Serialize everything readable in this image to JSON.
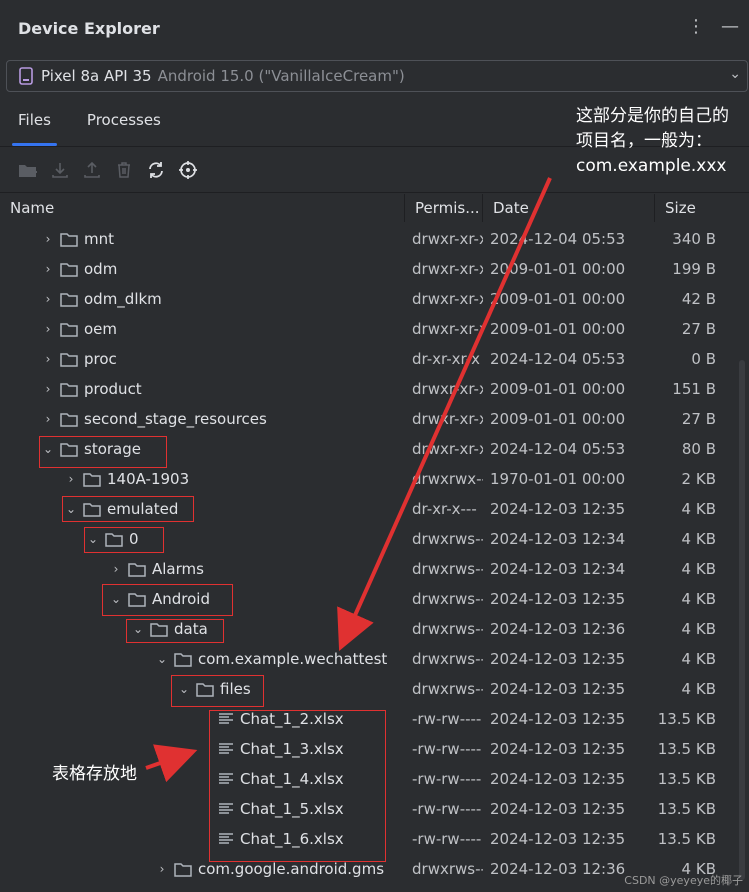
{
  "window": {
    "title": "Device Explorer"
  },
  "device": {
    "name": "Pixel 8a API 35",
    "meta": "Android 15.0 (\"VanillaIceCream\")"
  },
  "tabs": [
    {
      "label": "Files"
    },
    {
      "label": "Processes"
    }
  ],
  "columns": {
    "name": "Name",
    "perm": "Permis...",
    "date": "Date",
    "size": "Size"
  },
  "rows": [
    {
      "name": "mnt",
      "perm": "drwxr-xr-x",
      "date": "2024-12-04 05:53",
      "size": "340 B"
    },
    {
      "name": "odm",
      "perm": "drwxr-xr-x",
      "date": "2009-01-01 00:00",
      "size": "199 B"
    },
    {
      "name": "odm_dlkm",
      "perm": "drwxr-xr-x",
      "date": "2009-01-01 00:00",
      "size": "42 B"
    },
    {
      "name": "oem",
      "perm": "drwxr-xr-x",
      "date": "2009-01-01 00:00",
      "size": "27 B"
    },
    {
      "name": "proc",
      "perm": "dr-xr-xr-x",
      "date": "2024-12-04 05:53",
      "size": "0 B"
    },
    {
      "name": "product",
      "perm": "drwxr-xr-x",
      "date": "2009-01-01 00:00",
      "size": "151 B"
    },
    {
      "name": "second_stage_resources",
      "perm": "drwxr-xr-x",
      "date": "2009-01-01 00:00",
      "size": "27 B"
    },
    {
      "name": "storage",
      "perm": "drwxr-xr-x",
      "date": "2024-12-04 05:53",
      "size": "80 B"
    },
    {
      "name": "140A-1903",
      "perm": "drwxrwx--x",
      "date": "1970-01-01 00:00",
      "size": "2 KB"
    },
    {
      "name": "emulated",
      "perm": "dr-xr-x---",
      "date": "2024-12-03 12:35",
      "size": "4 KB"
    },
    {
      "name": "0",
      "perm": "drwxrws---",
      "date": "2024-12-03 12:34",
      "size": "4 KB"
    },
    {
      "name": "Alarms",
      "perm": "drwxrws---",
      "date": "2024-12-03 12:34",
      "size": "4 KB"
    },
    {
      "name": "Android",
      "perm": "drwxrws---",
      "date": "2024-12-03 12:35",
      "size": "4 KB"
    },
    {
      "name": "data",
      "perm": "drwxrws---",
      "date": "2024-12-03 12:36",
      "size": "4 KB"
    },
    {
      "name": "com.example.wechattest",
      "perm": "drwxrws---",
      "date": "2024-12-03 12:35",
      "size": "4 KB"
    },
    {
      "name": "files",
      "perm": "drwxrws---",
      "date": "2024-12-03 12:35",
      "size": "4 KB"
    },
    {
      "name": "Chat_1_2.xlsx",
      "perm": "-rw-rw----",
      "date": "2024-12-03 12:35",
      "size": "13.5 KB"
    },
    {
      "name": "Chat_1_3.xlsx",
      "perm": "-rw-rw----",
      "date": "2024-12-03 12:35",
      "size": "13.5 KB"
    },
    {
      "name": "Chat_1_4.xlsx",
      "perm": "-rw-rw----",
      "date": "2024-12-03 12:35",
      "size": "13.5 KB"
    },
    {
      "name": "Chat_1_5.xlsx",
      "perm": "-rw-rw----",
      "date": "2024-12-03 12:35",
      "size": "13.5 KB"
    },
    {
      "name": "Chat_1_6.xlsx",
      "perm": "-rw-rw----",
      "date": "2024-12-03 12:35",
      "size": "13.5 KB"
    },
    {
      "name": "com.google.android.gms",
      "perm": "drwxrws---",
      "date": "2024-12-03 12:36",
      "size": "4 KB"
    }
  ],
  "annotations": {
    "top": [
      "这部分是你的自己的",
      "项目名，一般为：",
      "com.example.xxx"
    ],
    "left": "表格存放地"
  },
  "watermark": "CSDN @yeyeye的椰子",
  "colors": {
    "accent": "#3574f0",
    "highlight": "#e03131",
    "folder": "#aeb3bb"
  }
}
